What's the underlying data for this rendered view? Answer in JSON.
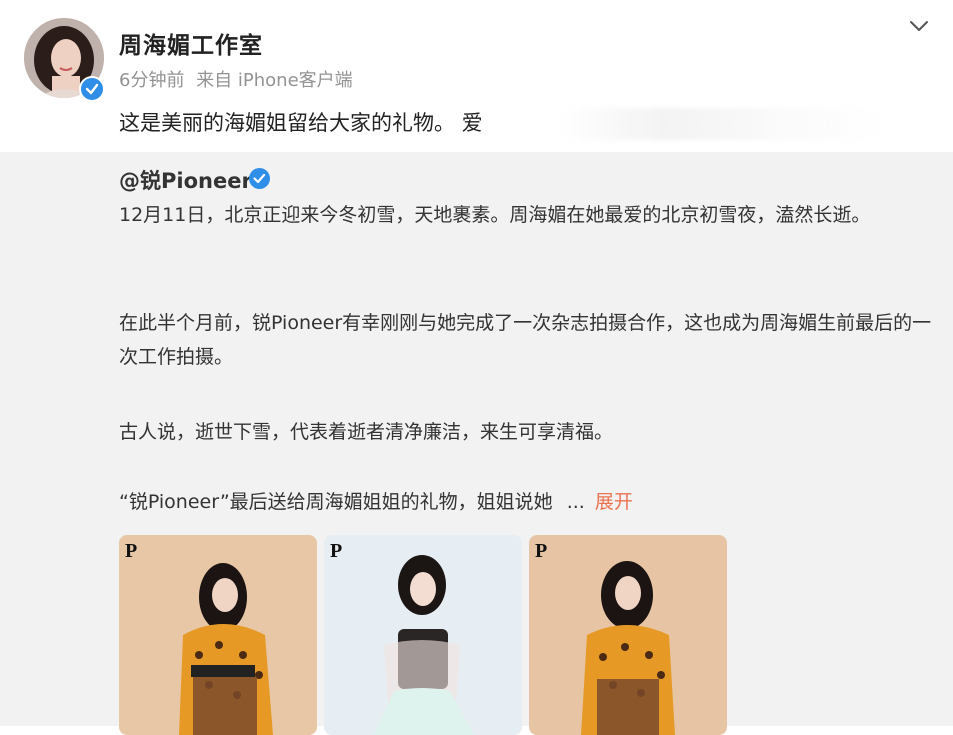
{
  "post": {
    "author": "周海媚工作室",
    "time": "6分钟前",
    "source": "来自 iPhone客户端",
    "text": "这是美丽的海媚姐留给大家的礼物。 爱"
  },
  "repost": {
    "author": "@锐Pioneer",
    "paragraphs": [
      "12月11日，北京正迎来今冬初雪，天地裹素。周海媚在她最爱的北京初雪夜，溘然长逝。",
      "在此半个月前，锐Pioneer有幸刚刚与她完成了一次杂志拍摄合作，这也成为周海媚生前最后的一次工作拍摄。",
      "古人说，逝世下雪，代表着逝者清净廉洁，来生可享清福。",
      "“锐Pioneer”最后送给周海媚姐姐的礼物，姐姐说她"
    ],
    "ellipsis": "...",
    "expand_label": "展开",
    "images": [
      {
        "name": "photo-1",
        "logo": "P"
      },
      {
        "name": "photo-2",
        "logo": "P"
      },
      {
        "name": "photo-3",
        "logo": "P"
      }
    ]
  },
  "colors": {
    "accent_link": "#eb7350",
    "verified_blue": "#2e8ee8",
    "meta_gray": "#939393",
    "repost_bg": "#f2f2f2"
  },
  "icons": {
    "more": "chevron-down-icon",
    "verified": "verified-badge-icon"
  }
}
